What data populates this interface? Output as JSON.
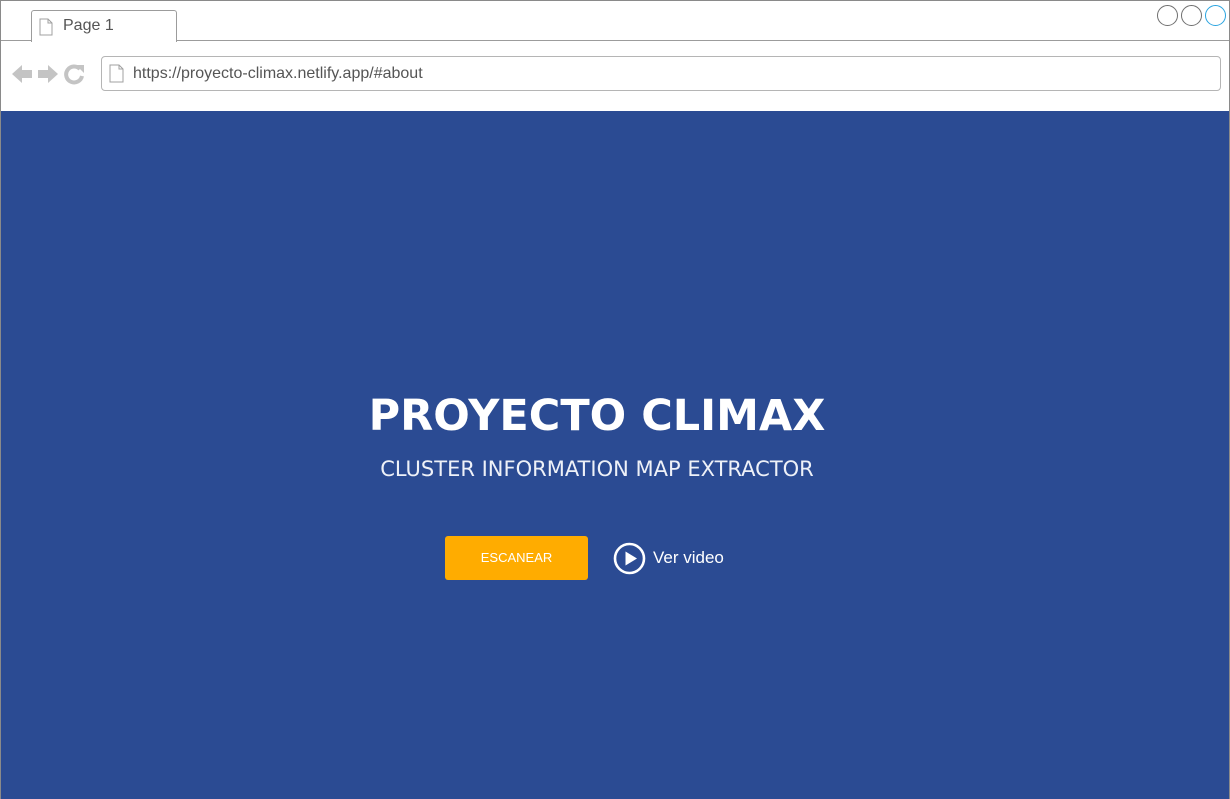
{
  "browser": {
    "tab": {
      "label": "Page 1"
    },
    "window_controls": [
      "minimize-icon",
      "maximize-icon",
      "close-icon"
    ],
    "nav_icons": [
      "back-arrow-icon",
      "forward-arrow-icon",
      "reload-icon"
    ],
    "address_bar": {
      "url": "https://proyecto-climax.netlify.app/#about"
    }
  },
  "hero": {
    "title": "PROYECTO CLIMAX",
    "subtitle": "CLUSTER INFORMATION MAP EXTRACTOR",
    "scan_button_label": "ESCANEAR",
    "video_link_label": "Ver video"
  },
  "colors": {
    "hero_background": "#2b4b93",
    "cta_button": "#ffac00",
    "text_light": "#ffffff"
  }
}
